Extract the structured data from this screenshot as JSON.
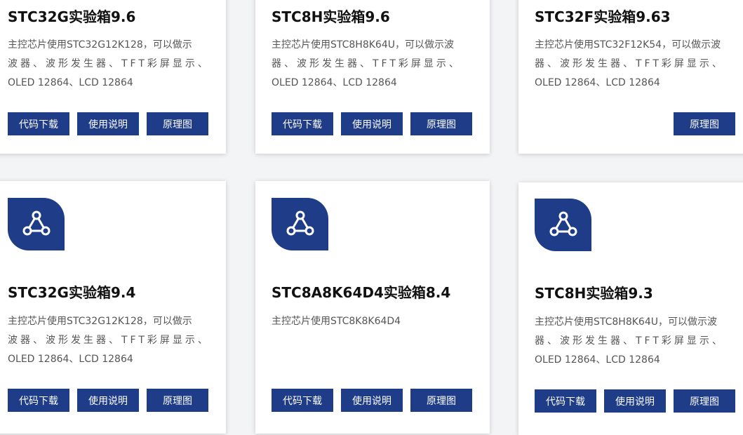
{
  "colors": {
    "accent": "#1f3c88",
    "card_bg": "#ffffff",
    "page_bg": "#f3f4f6"
  },
  "icon": "share-network-icon",
  "cards": [
    {
      "title": "STC32G实验箱9.6",
      "desc": [
        "主控芯片使用STC32G12K128，可以做示",
        "波器、波形发生器、TFT彩屏显示、",
        "OLED 12864、LCD 12864"
      ],
      "buttons": [
        "代码下载",
        "使用说明",
        "原理图"
      ]
    },
    {
      "title": "STC8H实验箱9.6",
      "desc": [
        "主控芯片使用STC8H8K64U，可以做示波",
        "器、波形发生器、TFT彩屏显示、",
        "OLED 12864、LCD 12864"
      ],
      "buttons": [
        "代码下载",
        "使用说明",
        "原理图"
      ]
    },
    {
      "title": "STC32F实验箱9.63",
      "desc": [
        "主控芯片使用STC32F12K54，可以做示波",
        "器、波形发生器、TFT彩屏显示、",
        "OLED 12864、LCD 12864"
      ],
      "buttons": [
        "原理图"
      ]
    },
    {
      "title": "STC32G实验箱9.4",
      "desc": [
        "主控芯片使用STC32G12K128，可以做示",
        "波器、波形发生器、TFT彩屏显示、",
        "OLED 12864、LCD 12864"
      ],
      "buttons": [
        "代码下载",
        "使用说明",
        "原理图"
      ]
    },
    {
      "title": "STC8A8K64D4实验箱8.4",
      "desc": [
        "主控芯片使用STC8K8K64D4"
      ],
      "buttons": [
        "代码下载",
        "使用说明",
        "原理图"
      ]
    },
    {
      "title": "STC8H实验箱9.3",
      "desc": [
        "主控芯片使用STC8H8K64U，可以做示波",
        "器、波形发生器、TFT彩屏显示、",
        "OLED 12864、LCD 12864"
      ],
      "buttons": [
        "代码下载",
        "使用说明",
        "原理图"
      ]
    }
  ]
}
